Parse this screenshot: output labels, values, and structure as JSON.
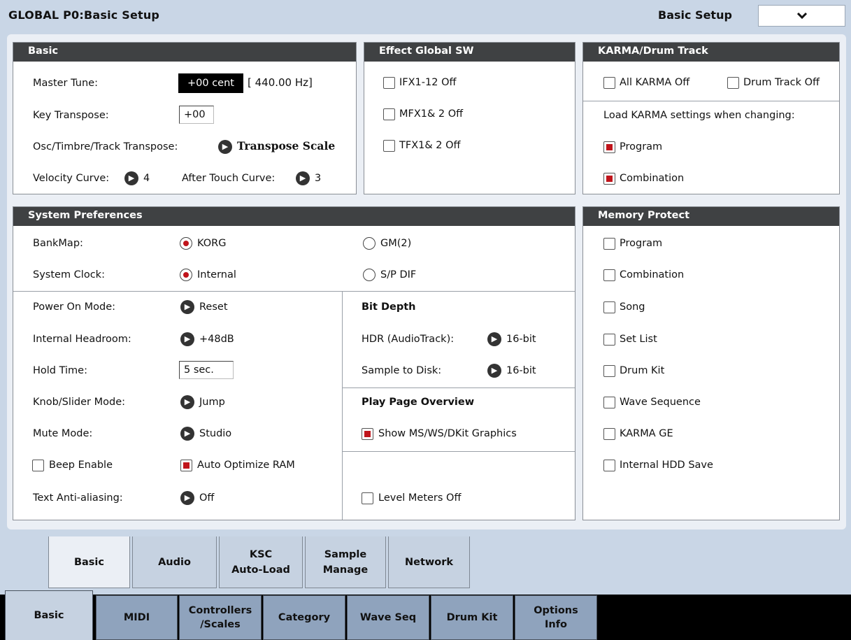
{
  "header": {
    "title": "GLOBAL P0:Basic Setup",
    "page_label": "Basic Setup",
    "menu_icon": "chevron-down-icon"
  },
  "basic": {
    "heading": "Basic",
    "master_tune_label": "Master Tune:",
    "master_tune_value": "+00 cent",
    "master_tune_hz": "[ 440.00 Hz]",
    "key_transpose_label": "Key Transpose:",
    "key_transpose_value": "+00",
    "osc_transpose_label": "Osc/Timbre/Track Transpose:",
    "osc_transpose_value": "Transpose Scale",
    "velocity_curve_label": "Velocity Curve:",
    "velocity_curve_value": "4",
    "aftertouch_curve_label": "After Touch Curve:",
    "aftertouch_curve_value": "3"
  },
  "effect": {
    "heading": "Effect Global SW",
    "items": [
      {
        "label": "IFX1-12 Off",
        "checked": false
      },
      {
        "label": "MFX1& 2 Off",
        "checked": false
      },
      {
        "label": "TFX1& 2 Off",
        "checked": false
      }
    ]
  },
  "karma": {
    "heading": "KARMA/Drum Track",
    "all_karma_off": "All KARMA Off",
    "drum_track_off": "Drum Track Off",
    "load_label": "Load KARMA settings when changing:",
    "program": "Program",
    "combination": "Combination"
  },
  "system": {
    "heading": "System Preferences",
    "bankmap_label": "BankMap:",
    "bankmap_korg": "KORG",
    "bankmap_gm": "GM(2)",
    "clock_label": "System Clock:",
    "clock_internal": "Internal",
    "clock_spdif": "S/P DIF",
    "power_on_label": "Power On Mode:",
    "power_on_value": "Reset",
    "headroom_label": "Internal Headroom:",
    "headroom_value": "+48dB",
    "hold_time_label": "Hold Time:",
    "hold_time_value": "5 sec.",
    "knob_label": "Knob/Slider Mode:",
    "knob_value": "Jump",
    "mute_label": "Mute Mode:",
    "mute_value": "Studio",
    "beep_label": "Beep Enable",
    "auto_opt_label": "Auto Optimize RAM",
    "aa_label": "Text Anti-aliasing:",
    "aa_value": "Off",
    "bit_depth_heading": "Bit Depth",
    "hdr_label": "HDR (AudioTrack):",
    "hdr_value": "16-bit",
    "s2d_label": "Sample to Disk:",
    "s2d_value": "16-bit",
    "overview_heading": "Play Page Overview",
    "show_graphics_label": "Show MS/WS/DKit Graphics",
    "level_meters_label": "Level Meters Off"
  },
  "memory": {
    "heading": "Memory Protect",
    "items": [
      {
        "label": "Program"
      },
      {
        "label": "Combination"
      },
      {
        "label": "Song"
      },
      {
        "label": "Set List"
      },
      {
        "label": "Drum Kit"
      },
      {
        "label": "Wave Sequence"
      },
      {
        "label": "KARMA GE"
      },
      {
        "label": "Internal HDD Save"
      }
    ]
  },
  "subtabs": {
    "basic": "Basic",
    "audio": "Audio",
    "ksc_1": "KSC",
    "ksc_2": "Auto-Load",
    "sample_1": "Sample",
    "sample_2": "Manage",
    "network": "Network"
  },
  "tabs": {
    "basic": "Basic",
    "midi": "MIDI",
    "controllers_1": "Controllers",
    "controllers_2": "/Scales",
    "category": "Category",
    "waveseq": "Wave Seq",
    "drumkit": "Drum Kit",
    "options_1": "Options",
    "options_2": "Info"
  },
  "colors": {
    "accent_red": "#c0141b",
    "panel_header": "#3f4143",
    "tab_blue": "#8fa3bd"
  }
}
